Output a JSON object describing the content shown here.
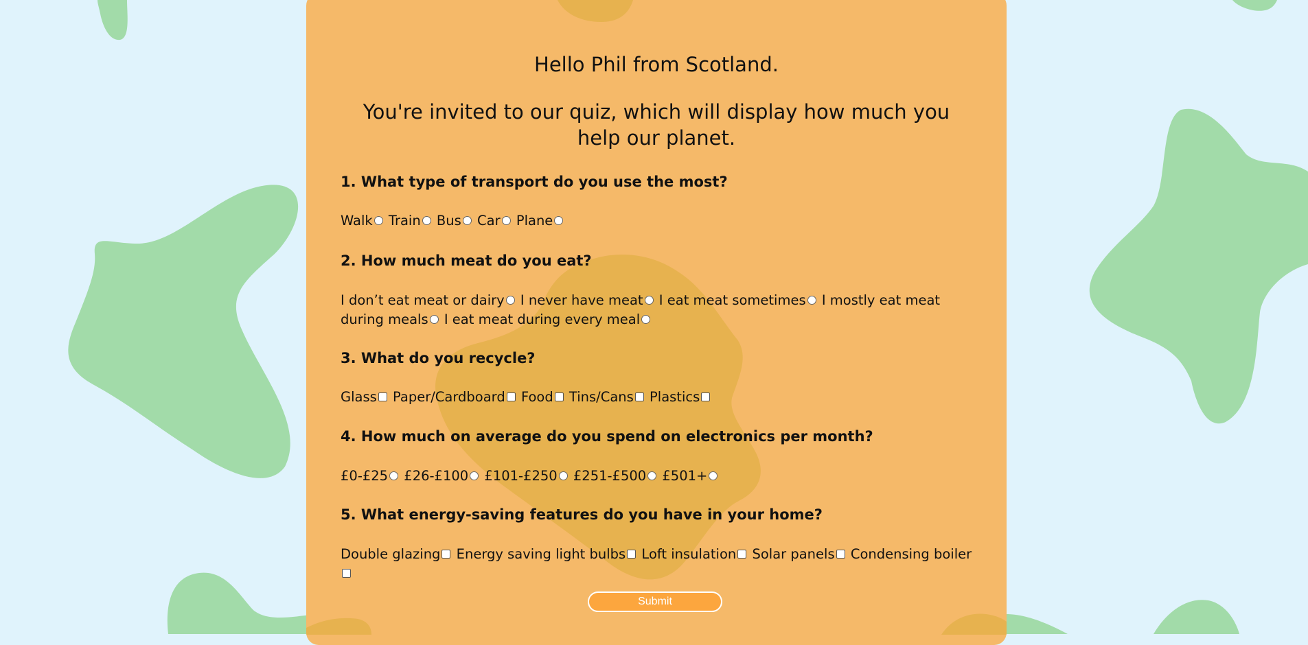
{
  "header": {
    "greeting": "Hello Phil from Scotland.",
    "intro": "You're invited to our quiz, which will display how much you help our planet."
  },
  "questions": [
    {
      "title": "1. What type of transport do you use the most?",
      "input_type": "radio",
      "options": [
        "Walk",
        "Train",
        "Bus",
        "Car",
        "Plane"
      ]
    },
    {
      "title": "2. How much meat do you eat?",
      "input_type": "radio",
      "options": [
        "I don’t eat meat or dairy",
        "I never have meat",
        "I eat meat sometimes",
        "I mostly eat meat during meals",
        "I eat meat during every meal"
      ]
    },
    {
      "title": "3. What do you recycle?",
      "input_type": "checkbox",
      "options": [
        "Glass",
        "Paper/Cardboard",
        "Food",
        "Tins/Cans",
        "Plastics"
      ]
    },
    {
      "title": "4. How much on average do you spend on electronics per month?",
      "input_type": "radio",
      "options": [
        "£0-£25",
        "£26-£100",
        "£101-£250",
        "£251-£500",
        "£501+"
      ]
    },
    {
      "title": "5. What energy-saving features do you have in your home?",
      "input_type": "checkbox",
      "options": [
        "Double glazing",
        "Energy saving light bulbs",
        "Loft insulation",
        "Solar panels",
        "Condensing boiler"
      ]
    }
  ],
  "submit_label": "Submit",
  "colors": {
    "page_background": "#e0f3fc",
    "blob_green": "#a2dba9",
    "card": "#f5b969",
    "card_blob": "#e7b24f",
    "submit": "#fca63e"
  }
}
